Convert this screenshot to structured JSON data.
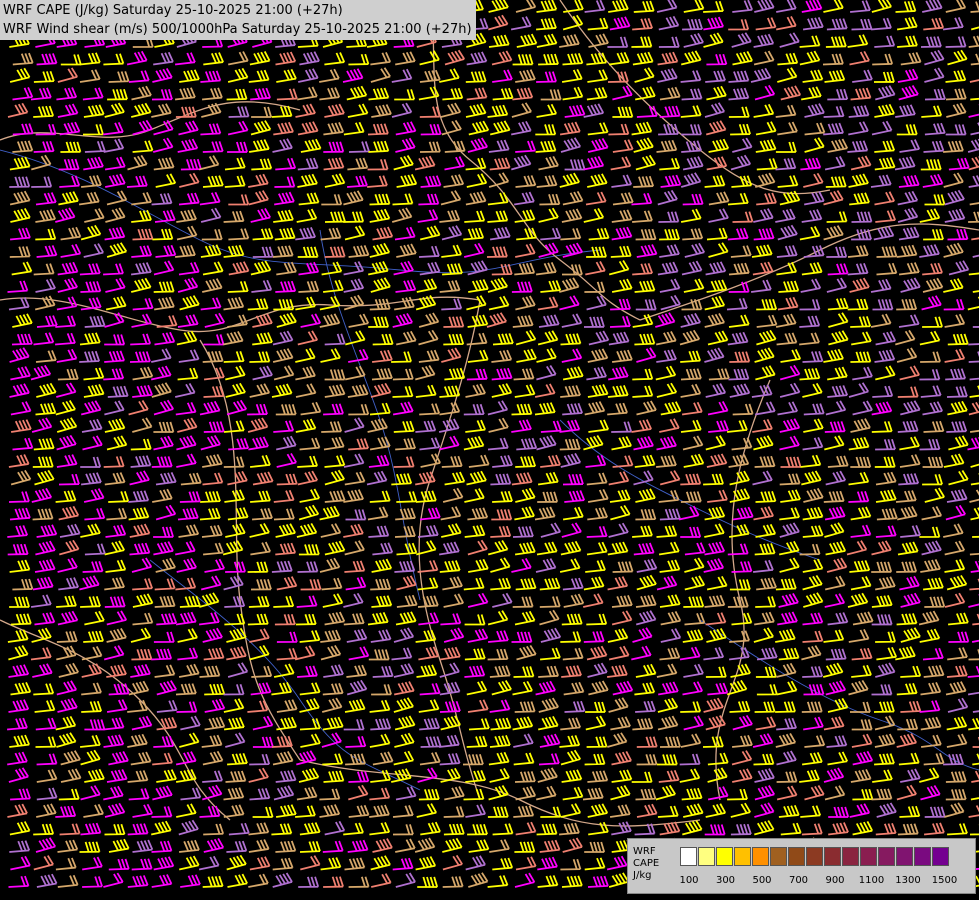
{
  "header": {
    "line1": "WRF CAPE (J/kg) Saturday 25-10-2025 21:00 (+27h)",
    "line2": "WRF Wind shear (m/s) 500/1000hPa Saturday 25-10-2025 21:00 (+27h)"
  },
  "legend": {
    "labels": [
      "WRF",
      "CAPE",
      "J/kg"
    ],
    "swatch_colors": [
      "#ffffff",
      "#ffff80",
      "#ffff00",
      "#ffc000",
      "#ff9000",
      "#a06020",
      "#904a18",
      "#8c3a22",
      "#8a2c30",
      "#8a2440",
      "#8a1e50",
      "#861a60",
      "#801470",
      "#7a0a80",
      "#740090"
    ],
    "ticks": [
      "100",
      "300",
      "500",
      "700",
      "900",
      "1100",
      "1300",
      "1500"
    ]
  },
  "map": {
    "barb_colors": [
      "#ffff00",
      "#ffff00",
      "#ffff00",
      "#d6a86a",
      "#d6a86a",
      "#f08070",
      "#ff00ff",
      "#b070d0"
    ],
    "border_color": "#d4a88a",
    "river_color": "#4060c8",
    "background": "#000000"
  }
}
